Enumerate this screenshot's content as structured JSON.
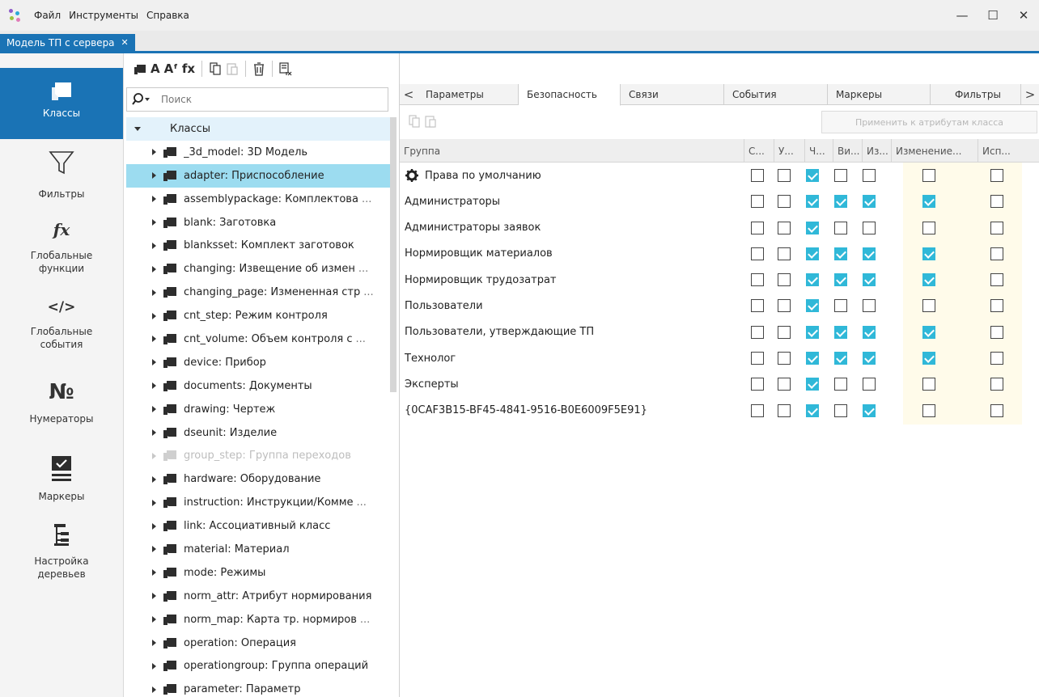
{
  "menubar": {
    "items": [
      "Файл",
      "Инструменты",
      "Справка"
    ]
  },
  "window_controls": {
    "minimize": "—",
    "maximize": "☐",
    "close": "✕"
  },
  "doc_tab": {
    "label": "Модель ТП с сервера",
    "close": "✕"
  },
  "leftnav": {
    "items": [
      {
        "label": "Классы",
        "active": true
      },
      {
        "label": "Фильтры"
      },
      {
        "label": "Глобальные функции"
      },
      {
        "label": "Глобальные события"
      },
      {
        "label": "Нумераторы"
      },
      {
        "label": "Маркеры"
      },
      {
        "label": "Настройка деревьев"
      }
    ],
    "icon_texts": {
      "functions": "fx",
      "events": "</>",
      "numerators": "№"
    }
  },
  "toolbar": {
    "text_a": "A",
    "text_af": "Aᶠ",
    "text_fx": "fx"
  },
  "search": {
    "placeholder": "Поиск"
  },
  "tree": {
    "root": "Классы",
    "items": [
      {
        "label": "_3d_model: 3D Модель"
      },
      {
        "label": "adapter: Приспособление",
        "selected": true
      },
      {
        "label": "assemblypackage: Комплектова",
        "more": "..."
      },
      {
        "label": "blank: Заготовка"
      },
      {
        "label": "blanksset: Комплект заготовок"
      },
      {
        "label": "changing: Извещение об измен",
        "more": "..."
      },
      {
        "label": "changing_page: Измененная стр",
        "more": "..."
      },
      {
        "label": "cnt_step: Режим контроля"
      },
      {
        "label": "cnt_volume: Объем контроля с",
        "more": "..."
      },
      {
        "label": "device: Прибор"
      },
      {
        "label": "documents: Документы"
      },
      {
        "label": "drawing: Чертеж"
      },
      {
        "label": "dseunit: Изделие"
      },
      {
        "label": "group_step: Группа переходов",
        "dim": true
      },
      {
        "label": "hardware: Оборудование"
      },
      {
        "label": "instruction: Инструкции/Комме",
        "more": "..."
      },
      {
        "label": "link: Ассоциативный класс"
      },
      {
        "label": "material: Материал"
      },
      {
        "label": "mode: Режимы"
      },
      {
        "label": "norm_attr: Атрибут нормирования"
      },
      {
        "label": "norm_map: Карта тр. нормиров",
        "more": "..."
      },
      {
        "label": "operation: Операция"
      },
      {
        "label": "operationgroup: Группа операций"
      },
      {
        "label": "parameter: Параметр"
      }
    ]
  },
  "tabs": {
    "prev": "<",
    "next": ">",
    "items": [
      "Параметры",
      "Безопасность",
      "Связи",
      "События",
      "Маркеры",
      "Фильтры"
    ],
    "active": "Безопасность"
  },
  "apply_button": "Применить к атрибутам класса",
  "grid": {
    "columns": [
      "Группа",
      "С...",
      "У...",
      "Ч...",
      "Ви...",
      "Из...",
      "Изменение...",
      "Исп..."
    ],
    "rows": [
      {
        "name": "Права по умолчанию",
        "icon": "gear-icon",
        "checks": [
          false,
          false,
          true,
          false,
          false,
          false,
          false
        ]
      },
      {
        "name": "Администраторы",
        "checks": [
          false,
          false,
          true,
          true,
          true,
          true,
          false
        ]
      },
      {
        "name": "Администраторы заявок",
        "checks": [
          false,
          false,
          true,
          false,
          false,
          false,
          false
        ]
      },
      {
        "name": "Нормировщик материалов",
        "checks": [
          false,
          false,
          true,
          true,
          true,
          true,
          false
        ]
      },
      {
        "name": "Нормировщик трудозатрат",
        "checks": [
          false,
          false,
          true,
          true,
          true,
          true,
          false
        ]
      },
      {
        "name": "Пользователи",
        "checks": [
          false,
          false,
          true,
          false,
          false,
          false,
          false
        ]
      },
      {
        "name": "Пользователи, утверждающие ТП",
        "checks": [
          false,
          false,
          true,
          true,
          true,
          true,
          false
        ]
      },
      {
        "name": "Технолог",
        "checks": [
          false,
          false,
          true,
          true,
          true,
          true,
          false
        ]
      },
      {
        "name": "Эксперты",
        "checks": [
          false,
          false,
          true,
          false,
          false,
          false,
          false
        ]
      },
      {
        "name": "{0CAF3B15-BF45-4841-9516-B0E6009F5E91}",
        "checks": [
          false,
          false,
          true,
          false,
          true,
          false,
          false
        ]
      }
    ]
  },
  "colors": {
    "accent": "#1a73b5",
    "selection": "#9cdcf0",
    "check": "#30b8d8",
    "highlight_column": "#fffbea"
  }
}
